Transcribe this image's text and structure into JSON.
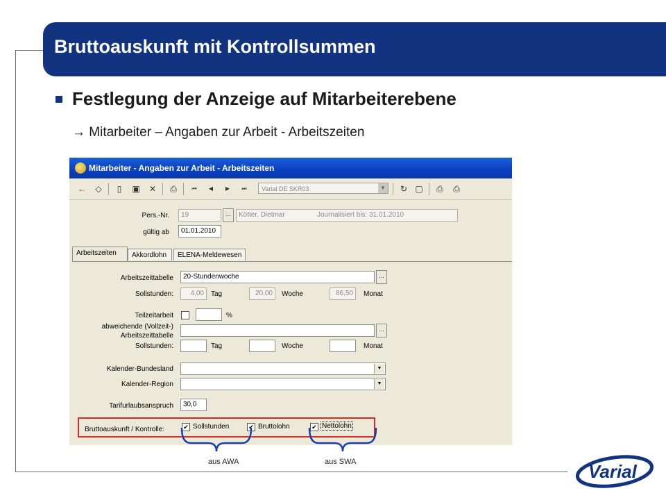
{
  "slide": {
    "title": "Bruttoauskunft mit Kontrollsummen",
    "heading": "Festlegung der Anzeige auf Mitarbeiterebene",
    "subheading": "→ Mitarbeiter – Angaben zur Arbeit - Arbeitszeiten",
    "annotation_left": "aus AWA",
    "annotation_right": "aus SWA",
    "logo_text": "Varial"
  },
  "window": {
    "title": "Mitarbeiter - Angaben zur Arbeit - Arbeitszeiten",
    "toolbar": {
      "company_select": "Varial DE SKR03",
      "icons": [
        "back-arrow-icon",
        "eraser-icon",
        "new-document-icon",
        "save-icon",
        "delete-icon",
        "print-icon",
        "first-record-icon",
        "previous-record-icon",
        "next-record-icon",
        "last-record-icon",
        "refresh-icon",
        "window-icon",
        "print-preview-icon",
        "print-setup-icon"
      ]
    }
  },
  "header_fields": {
    "pers_nr_label": "Pers.-Nr.",
    "pers_nr_value": "19",
    "lookup_button": "...",
    "name_value": "Kötter, Dietmar",
    "journal_value": "Journalisiert bis: 31.01.2010",
    "gueltig_label": "gültig ab",
    "gueltig_value": "01.01.2010"
  },
  "tabs": [
    "Arbeitszeiten",
    "Akkordlohn",
    "ELENA-Meldewesen"
  ],
  "form": {
    "arbeitszeittabelle_label": "Arbeitszeittabelle",
    "arbeitszeittabelle_value": "20-Stundenwoche",
    "sollstunden_label": "Sollstunden:",
    "tag_value": "4,00",
    "tag_label": "Tag",
    "woche_value": "20,00",
    "woche_label": "Woche",
    "monat_value": "86,50",
    "monat_label": "Monat",
    "teilzeit_label": "Teilzeitarbeit",
    "percent_label": "%",
    "abweichend_label_1": "abweichende (Vollzeit-)",
    "abweichend_label_2": "Arbeitszeittabelle",
    "sollstunden2_label": "Sollstunden:",
    "tag2_label": "Tag",
    "woche2_label": "Woche",
    "monat2_label": "Monat",
    "bundesland_label": "Kalender-Bundesland",
    "region_label": "Kalender-Region",
    "tarifurlaub_label": "Tarifurlaubsanspruch",
    "tarifurlaub_value": "30,0",
    "brutto_label": "Bruttoauskunft / Kontrolle:",
    "check_sollstunden": "Sollstunden",
    "check_bruttolohn": "Bruttolohn",
    "check_nettolohn": "Nettolohn",
    "check_mark": "✔"
  },
  "colors": {
    "title_bar": "#12337f",
    "highlight": "#d42a2a",
    "brace": "#1a3fa8"
  }
}
